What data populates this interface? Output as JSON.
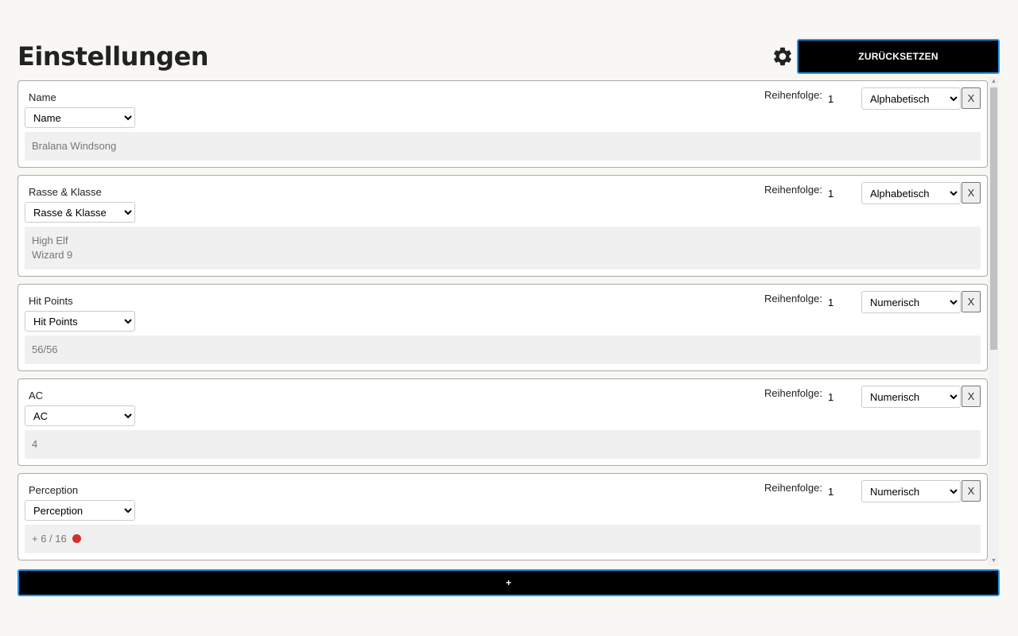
{
  "header": {
    "title": "Einstellungen",
    "settings_icon": "gear-icon",
    "reset_label": "ZURÜCKSETZEN"
  },
  "order_label": "Reihenfolge:",
  "remove_label": "X",
  "add_label": "+",
  "colors": {
    "accent_border": "#2196f3",
    "button_bg": "#000000",
    "status_dot": "#d32f2f"
  },
  "cards": [
    {
      "label": "Name",
      "field": "Name",
      "order": "1",
      "sort": "Alphabetisch",
      "values": [
        "Bralana Windsong"
      ],
      "dot": false
    },
    {
      "label": "Rasse & Klasse",
      "field": "Rasse & Klasse",
      "order": "1",
      "sort": "Alphabetisch",
      "values": [
        "High Elf",
        "Wizard 9"
      ],
      "dot": false
    },
    {
      "label": "Hit Points",
      "field": "Hit Points",
      "order": "1",
      "sort": "Numerisch",
      "values": [
        "56/56"
      ],
      "dot": false
    },
    {
      "label": "AC",
      "field": "AC",
      "order": "1",
      "sort": "Numerisch",
      "values": [
        "4"
      ],
      "dot": false
    },
    {
      "label": "Perception",
      "field": "Perception",
      "order": "1",
      "sort": "Numerisch",
      "values": [
        "+ 6 / 16"
      ],
      "dot": true
    }
  ]
}
